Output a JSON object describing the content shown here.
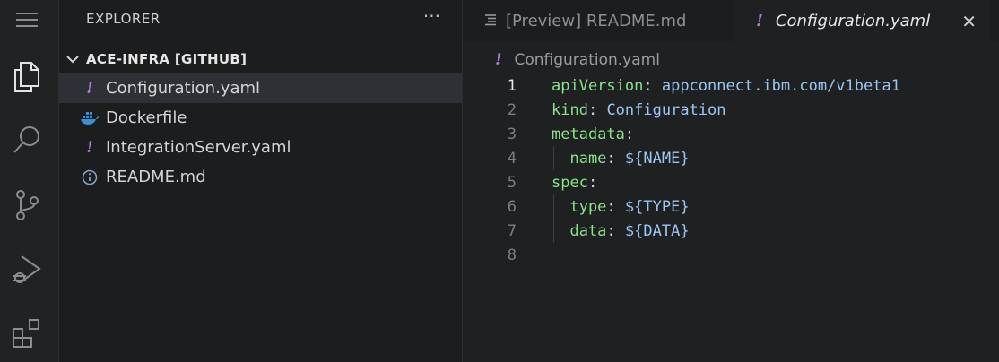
{
  "sidebar": {
    "title": "EXPLORER",
    "more": "···",
    "folder": "ACE-INFRA [GITHUB]",
    "files": [
      {
        "name": "Configuration.yaml",
        "icon": "yaml-icon"
      },
      {
        "name": "Dockerfile",
        "icon": "docker-icon"
      },
      {
        "name": "IntegrationServer.yaml",
        "icon": "yaml-icon"
      },
      {
        "name": "README.md",
        "icon": "info-icon"
      }
    ]
  },
  "tabs": [
    {
      "label": "[Preview] README.md",
      "icon": "preview-icon"
    },
    {
      "label": "Configuration.yaml",
      "icon": "yaml-icon",
      "close": "✕"
    }
  ],
  "breadcrumb": "Configuration.yaml",
  "editor": {
    "lines": [
      {
        "num": "1",
        "key": "apiVersion",
        "sep": ":",
        "value": " appconnect.ibm.com/v1beta1"
      },
      {
        "num": "2",
        "key": "kind",
        "sep": ":",
        "value": " Configuration"
      },
      {
        "num": "3",
        "key": "metadata",
        "sep": ":",
        "value": ""
      },
      {
        "num": "4",
        "key": "  name",
        "sep": ":",
        "value": " ${NAME}"
      },
      {
        "num": "5",
        "key": "spec",
        "sep": ":",
        "value": ""
      },
      {
        "num": "6",
        "key": "  type",
        "sep": ":",
        "value": " ${TYPE}"
      },
      {
        "num": "7",
        "key": "  data",
        "sep": ":",
        "value": " ${DATA}"
      },
      {
        "num": "8",
        "key": "",
        "sep": "",
        "value": ""
      }
    ]
  },
  "colors": {
    "key": "#8be28b",
    "value": "#9cc6f2",
    "yaml_icon": "#b07ad8"
  }
}
